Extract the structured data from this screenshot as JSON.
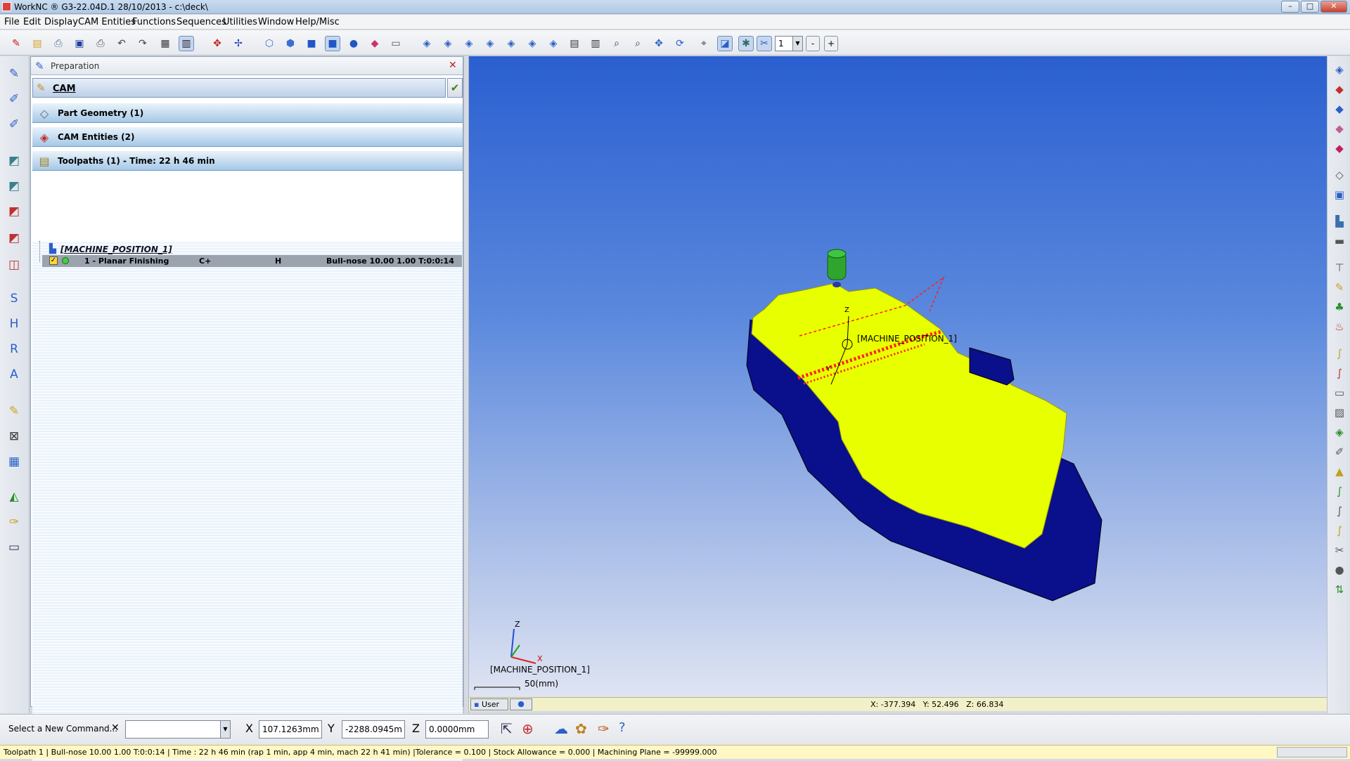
{
  "window": {
    "title": "WorkNC ® G3-22.04D.1  28/10/2013 - c:\\deck\\"
  },
  "menu": [
    "File",
    "Edit",
    "Display",
    "CAM Entities",
    "Functions",
    "Sequences",
    "Utilities",
    "Window",
    "Help/Misc"
  ],
  "toolbar": {
    "view_count": "1",
    "minus": "-",
    "plus": "+"
  },
  "panel": {
    "title": "Preparation",
    "cam_header": "CAM",
    "sections": [
      "Part Geometry (1)",
      "CAM Entities (2)",
      "Toolpaths (1) - Time: 22 h 46 min"
    ],
    "machine_position": "[MACHINE_POSITION_1]",
    "toolpath": {
      "name": "1 - Planar Finishing",
      "col2": "C+",
      "col3": "H",
      "tool": "Bull-nose 10.00 1.00 T:0:0:14"
    }
  },
  "viewport": {
    "part_label": "[MACHINE_POSITION_1]",
    "axis_z": "Z",
    "axis_y": "Y",
    "axis_x": "X",
    "triad_label": "[MACHINE_POSITION_1]",
    "scale_label": "50(mm)",
    "user_tab": "User",
    "coords": "X: -377.394   Y: 52.496   Z: 66.834"
  },
  "command": {
    "prompt": "Select a New Command...",
    "x_label": "X",
    "x_value": "107.1263mm",
    "y_label": "Y",
    "y_value": "-2288.0945mm",
    "z_label": "Z",
    "z_value": "0.0000mm"
  },
  "status": "Toolpath 1 | Bull-nose 10.00 1.00 T:0:0:14 | Time : 22 h 46 min (rap 1 min, app 4 min, mach 22 h 41 min) |Tolerance = 0.100 | Stock Allowance = 0.000 | Machining Plane = -99999.000",
  "colors": {
    "part_top": "#e8ff00",
    "part_side": "#0a0f8c",
    "toolpath": "#ff2020",
    "tool": "#2fa52f"
  }
}
